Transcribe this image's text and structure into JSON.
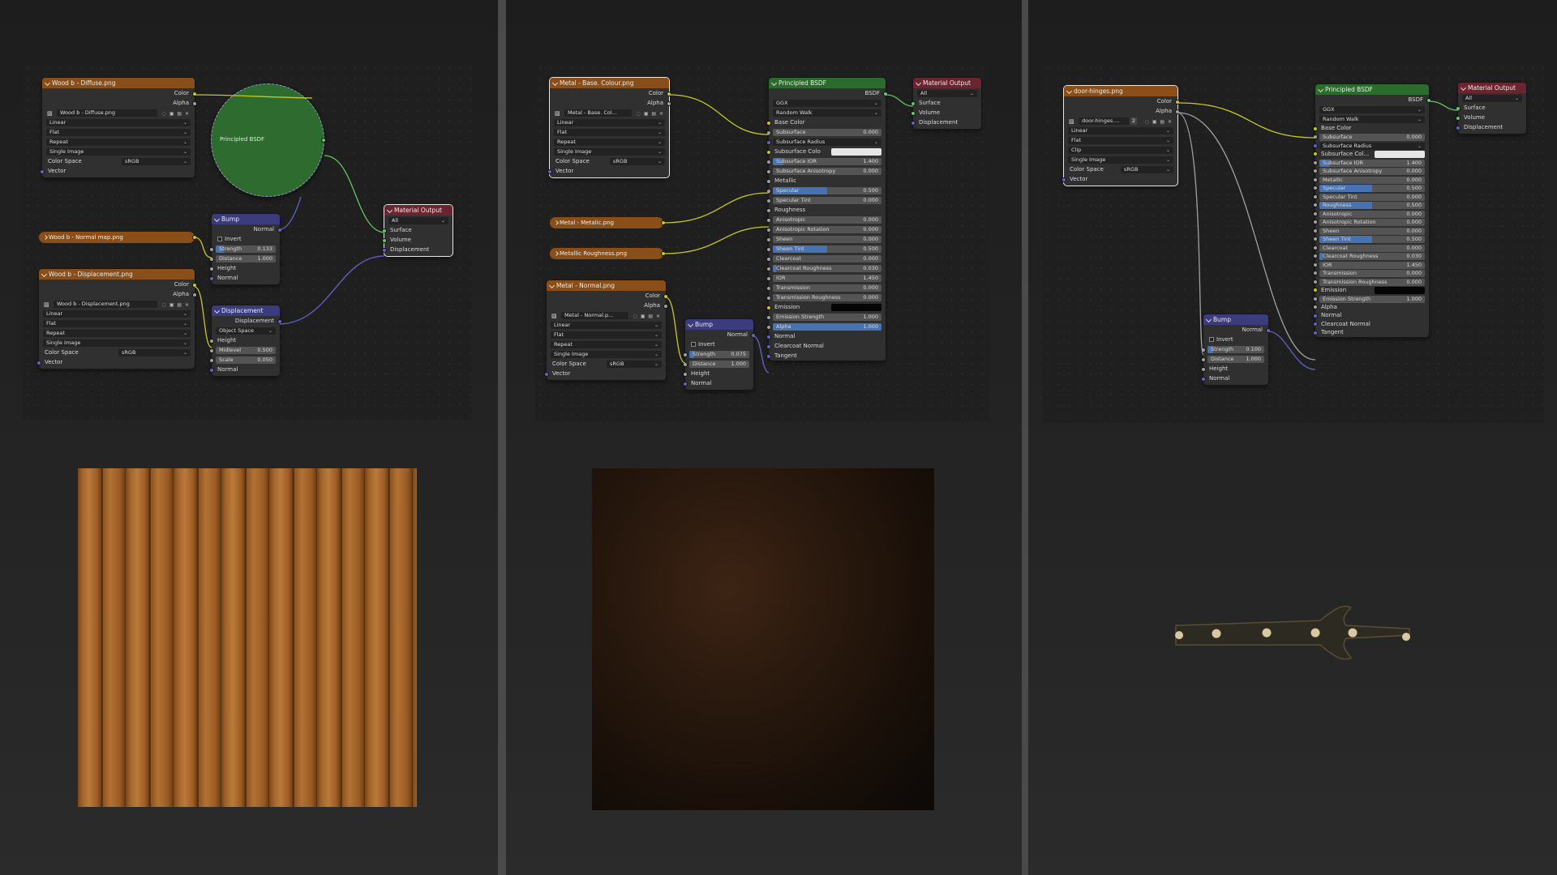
{
  "panel1": {
    "diffuse": {
      "title": "Wood b - Diffuse.png",
      "out_color": "Color",
      "out_alpha": "Alpha",
      "image": "Wood b - Diffuse.png",
      "interp": "Linear",
      "proj": "Flat",
      "ext": "Repeat",
      "src": "Single Image",
      "cs_label": "Color Space",
      "cs_value": "sRGB",
      "vector": "Vector"
    },
    "principled_collapsed": "Principled BSDF",
    "bump": {
      "title": "Bump",
      "out": "Normal",
      "invert": "Invert",
      "strength_label": "Strength",
      "strength": "0.133",
      "distance_label": "Distance",
      "distance": "1.000",
      "height": "Height",
      "normal": "Normal"
    },
    "normal_map": "Wood b - Normal map.png",
    "displacement_tex": {
      "title": "Wood b - Displacement.png",
      "out_color": "Color",
      "out_alpha": "Alpha",
      "image": "Wood b - Displacement.png",
      "interp": "Linear",
      "proj": "Flat",
      "ext": "Repeat",
      "src": "Single Image",
      "cs_label": "Color Space",
      "cs_value": "sRGB",
      "vector": "Vector"
    },
    "displacement": {
      "title": "Displacement",
      "out": "Displacement",
      "space": "Object Space",
      "height": "Height",
      "midlevel_label": "Midlevel",
      "midlevel": "0.500",
      "scale_label": "Scale",
      "scale": "0.050",
      "normal": "Normal"
    },
    "output": {
      "title": "Material Output",
      "target": "All",
      "surface": "Surface",
      "volume": "Volume",
      "displacement": "Displacement"
    }
  },
  "panel2": {
    "base": {
      "title": "Metal - Base. Colour.png",
      "out_color": "Color",
      "out_alpha": "Alpha",
      "image": "Metal - Base. Col...",
      "interp": "Linear",
      "proj": "Flat",
      "ext": "Repeat",
      "src": "Single Image",
      "cs_label": "Color Space",
      "cs_value": "sRGB",
      "vector": "Vector"
    },
    "metallic_tex": "Metal - Metalic.png",
    "rough_tex": "Metallic Roughness.png",
    "normal_tex": {
      "title": "Metal - Normal.png",
      "out_color": "Color",
      "out_alpha": "Alpha",
      "image": "Metal - Normal.p...",
      "interp": "Linear",
      "proj": "Flat",
      "ext": "Repeat",
      "src": "Single Image",
      "cs_label": "Color Space",
      "cs_value": "sRGB",
      "vector": "Vector"
    },
    "bump": {
      "title": "Bump",
      "out": "Normal",
      "invert": "Invert",
      "strength_label": "Strength",
      "strength": "0.075",
      "distance_label": "Distance",
      "distance": "1.000",
      "height": "Height",
      "normal": "Normal"
    },
    "bsdf": {
      "title": "Principled BSDF",
      "out": "BSDF",
      "dist": "GGX",
      "sss": "Random Walk",
      "rows": [
        {
          "label": "Base Color",
          "kind": "socket"
        },
        {
          "label": "Subsurface",
          "value": "0.000",
          "fill": 0
        },
        {
          "label": "Subsurface Radius",
          "kind": "dropdown"
        },
        {
          "label": "Subsurface Colo",
          "kind": "swatch",
          "color": "#e6e6e6"
        },
        {
          "label": "Subsurface IOR",
          "value": "1.400",
          "fill": 0.1
        },
        {
          "label": "Subsurface Anisotropy",
          "value": "0.000",
          "fill": 0
        },
        {
          "label": "Metallic",
          "kind": "socket"
        },
        {
          "label": "Specular",
          "value": "0.500",
          "fill": 0.5
        },
        {
          "label": "Specular Tint",
          "value": "0.000",
          "fill": 0
        },
        {
          "label": "Roughness",
          "kind": "socket"
        },
        {
          "label": "Anisotropic",
          "value": "0.000",
          "fill": 0
        },
        {
          "label": "Anisotropic Rotation",
          "value": "0.000",
          "fill": 0
        },
        {
          "label": "Sheen",
          "value": "0.000",
          "fill": 0
        },
        {
          "label": "Sheen Tint",
          "value": "0.500",
          "fill": 0.5
        },
        {
          "label": "Clearcoat",
          "value": "0.000",
          "fill": 0
        },
        {
          "label": "Clearcoat Roughness",
          "value": "0.030",
          "fill": 0.03
        },
        {
          "label": "IOR",
          "value": "1.450",
          "fill": 0
        },
        {
          "label": "Transmission",
          "value": "0.000",
          "fill": 0
        },
        {
          "label": "Transmission Roughness",
          "value": "0.000",
          "fill": 0
        },
        {
          "label": "Emission",
          "kind": "swatch",
          "color": "#050505"
        },
        {
          "label": "Emission Strength",
          "value": "1.000",
          "fill": 0
        },
        {
          "label": "Alpha",
          "value": "1.000",
          "fill": 1
        },
        {
          "label": "Normal",
          "kind": "socket"
        },
        {
          "label": "Clearcoat Normal",
          "kind": "socket"
        },
        {
          "label": "Tangent",
          "kind": "socket"
        }
      ]
    },
    "output": {
      "title": "Material Output",
      "target": "All",
      "surface": "Surface",
      "volume": "Volume",
      "displacement": "Displacement"
    }
  },
  "panel3": {
    "tex": {
      "title": "door-hinges.png",
      "out_color": "Color",
      "out_alpha": "Alpha",
      "image": "door-hinges....",
      "users": "2",
      "interp": "Linear",
      "proj": "Flat",
      "ext": "Clip",
      "src": "Single Image",
      "cs_label": "Color Space",
      "cs_value": "sRGB",
      "vector": "Vector"
    },
    "bump": {
      "title": "Bump",
      "out": "Normal",
      "invert": "Invert",
      "strength_label": "Strength",
      "strength": "0.100",
      "distance_label": "Distance",
      "distance": "1.000",
      "height": "Height",
      "normal": "Normal"
    },
    "bsdf": {
      "title": "Principled BSDF",
      "out": "BSDF",
      "dist": "GGX",
      "sss": "Random Walk",
      "rows": [
        {
          "label": "Base Color",
          "kind": "socket"
        },
        {
          "label": "Subsurface",
          "value": "0.000",
          "fill": 0
        },
        {
          "label": "Subsurface Radius",
          "kind": "dropdown"
        },
        {
          "label": "Subsurface Col...",
          "kind": "swatch",
          "color": "#e6e6e6"
        },
        {
          "label": "Subsurface IOR",
          "value": "1.400",
          "fill": 0.1
        },
        {
          "label": "Subsurface Anisotropy",
          "value": "0.000",
          "fill": 0
        },
        {
          "label": "Metallic",
          "value": "0.000",
          "fill": 0
        },
        {
          "label": "Specular",
          "value": "0.500",
          "fill": 0.5
        },
        {
          "label": "Specular Tint",
          "value": "0.000",
          "fill": 0
        },
        {
          "label": "Roughness",
          "value": "0.500",
          "fill": 0.5
        },
        {
          "label": "Anisotropic",
          "value": "0.000",
          "fill": 0
        },
        {
          "label": "Anisotropic Rotation",
          "value": "0.000",
          "fill": 0
        },
        {
          "label": "Sheen",
          "value": "0.000",
          "fill": 0
        },
        {
          "label": "Sheen Tint",
          "value": "0.500",
          "fill": 0.5
        },
        {
          "label": "Clearcoat",
          "value": "0.000",
          "fill": 0
        },
        {
          "label": "Clearcoat Roughness",
          "value": "0.030",
          "fill": 0.03
        },
        {
          "label": "IOR",
          "value": "1.450",
          "fill": 0
        },
        {
          "label": "Transmission",
          "value": "0.000",
          "fill": 0
        },
        {
          "label": "Transmission Roughness",
          "value": "0.000",
          "fill": 0
        },
        {
          "label": "Emission",
          "kind": "swatch",
          "color": "#050505"
        },
        {
          "label": "Emission Strength",
          "value": "1.000",
          "fill": 0
        },
        {
          "label": "Alpha",
          "kind": "socket"
        },
        {
          "label": "Normal",
          "kind": "socket"
        },
        {
          "label": "Clearcoat Normal",
          "kind": "socket"
        },
        {
          "label": "Tangent",
          "kind": "socket"
        }
      ]
    },
    "output": {
      "title": "Material Output",
      "target": "All",
      "surface": "Surface",
      "volume": "Volume",
      "displacement": "Displacement"
    }
  },
  "colors": {
    "texture_header": "#8a4f19",
    "vector_header": "#3b3b7e",
    "shader_header": "#2b6b2b",
    "output_header": "#6b2530",
    "slider_fill": "#4772b3"
  }
}
